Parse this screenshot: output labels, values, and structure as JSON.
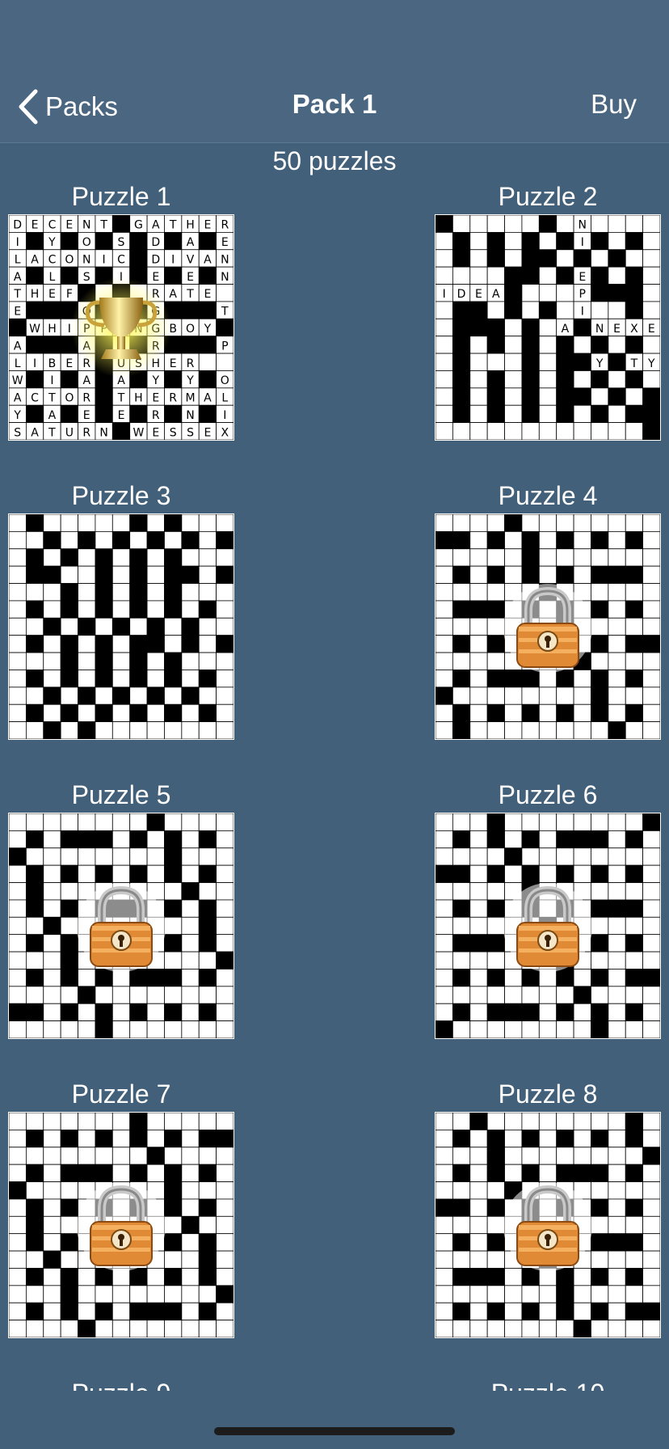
{
  "navbar": {
    "back_label": "Packs",
    "title": "Pack 1",
    "buy_label": "Buy"
  },
  "pack": {
    "count_label": "50 puzzles"
  },
  "puzzles": [
    {
      "title": "Puzzle 1",
      "status": "completed",
      "overlay_icon": "trophy-icon",
      "letters": [
        "DECENT GATHER",
        "I Y O S D A E",
        "LACONIC DIVAN",
        "A L S I E E N",
        "THEF O RATE",
        "E O G T",
        " WHIPPINGBOY ",
        "A A R P",
        "LIBER USHER",
        "W I A A Y Y O",
        "ACTOR THERMAL",
        "Y A E E R N I",
        "SATURN WESSEX"
      ]
    },
    {
      "title": "Puzzle 2",
      "status": "in-progress",
      "overlay_icon": "",
      "letters": [
        "IDEA",
        "ANNEXE",
        "YETY",
        "NINEPIS"
      ]
    },
    {
      "title": "Puzzle 3",
      "status": "unlocked",
      "overlay_icon": ""
    },
    {
      "title": "Puzzle 4",
      "status": "locked",
      "overlay_icon": "padlock-icon"
    },
    {
      "title": "Puzzle 5",
      "status": "locked",
      "overlay_icon": "padlock-icon"
    },
    {
      "title": "Puzzle 6",
      "status": "locked",
      "overlay_icon": "padlock-icon"
    },
    {
      "title": "Puzzle 7",
      "status": "locked",
      "overlay_icon": "padlock-icon"
    },
    {
      "title": "Puzzle 8",
      "status": "locked",
      "overlay_icon": "padlock-icon"
    },
    {
      "title": "Puzzle 9",
      "status": "locked",
      "overlay_icon": "padlock-icon"
    },
    {
      "title": "Puzzle 10",
      "status": "locked",
      "overlay_icon": "padlock-icon"
    }
  ],
  "colors": {
    "background": "#42607a",
    "navbar": "#4a6680",
    "text": "#ffffff",
    "cell_black": "#000000",
    "cell_white": "#ffffff"
  }
}
